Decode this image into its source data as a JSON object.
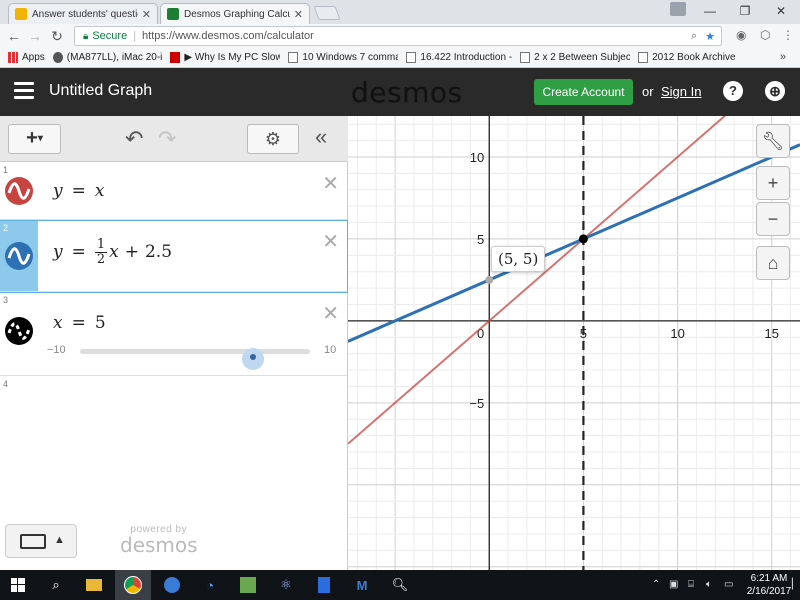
{
  "browser": {
    "tabs": [
      {
        "label": "Answer students' questic",
        "active": false
      },
      {
        "label": "Desmos Graphing Calcul",
        "active": true
      }
    ],
    "address": {
      "secure_label": "Secure",
      "url": "https://www.desmos.com/calculator"
    },
    "bookmarks": [
      {
        "label": "Apps"
      },
      {
        "label": "(MA877LL), iMac 20-i"
      },
      {
        "label": "▶ Why Is My PC Slow"
      },
      {
        "label": "10 Windows 7 comma"
      },
      {
        "label": "16.422 Introduction -"
      },
      {
        "label": "2 x 2 Between Subjec"
      },
      {
        "label": "2012 Book Archive"
      }
    ],
    "bookmarks_more": "»"
  },
  "header": {
    "graph_title": "Untitled Graph",
    "logo": "desmos",
    "create_account": "Create Account",
    "or": "or",
    "sign_in": "Sign In",
    "help": "?"
  },
  "expressions": [
    {
      "index": "1",
      "lhs": "y",
      "eq": "=",
      "rhs": "x",
      "color": "#c74440"
    },
    {
      "index": "2",
      "lhs": "y",
      "eq": "=",
      "frac_num": "1",
      "frac_den": "2",
      "rhs_var": "x",
      "plus": "+",
      "constant": "2.5",
      "color": "#2d70b3",
      "selected": true
    },
    {
      "index": "3",
      "lhs": "x",
      "eq": "=",
      "rhs": "5",
      "color": "#000000",
      "slider": {
        "min": "−10",
        "max": "10",
        "value": 5
      }
    },
    {
      "index": "4"
    }
  ],
  "footer": {
    "powered_by": "powered by",
    "brand": "desmos"
  },
  "graph": {
    "x_range": [
      -7.5,
      16.5
    ],
    "y_range": [
      -15.2,
      12.5
    ],
    "x_ticks": [
      5,
      10,
      15
    ],
    "y_ticks": [
      10,
      5,
      -5
    ],
    "origin_label": "0",
    "point": {
      "label": "(5, 5)",
      "x": 5,
      "y": 5
    },
    "lines": [
      {
        "expr": "y = x",
        "slope": 1,
        "intercept": 0,
        "color": "#c74440"
      },
      {
        "expr": "y = 1/2 x + 2.5",
        "slope": 0.5,
        "intercept": 2.5,
        "color": "#2d70b3"
      }
    ],
    "vertical_line_x": 5,
    "zoom_in": "+",
    "zoom_out": "−"
  },
  "taskbar": {
    "time": "6:21 AM",
    "date": "2/16/2017"
  }
}
